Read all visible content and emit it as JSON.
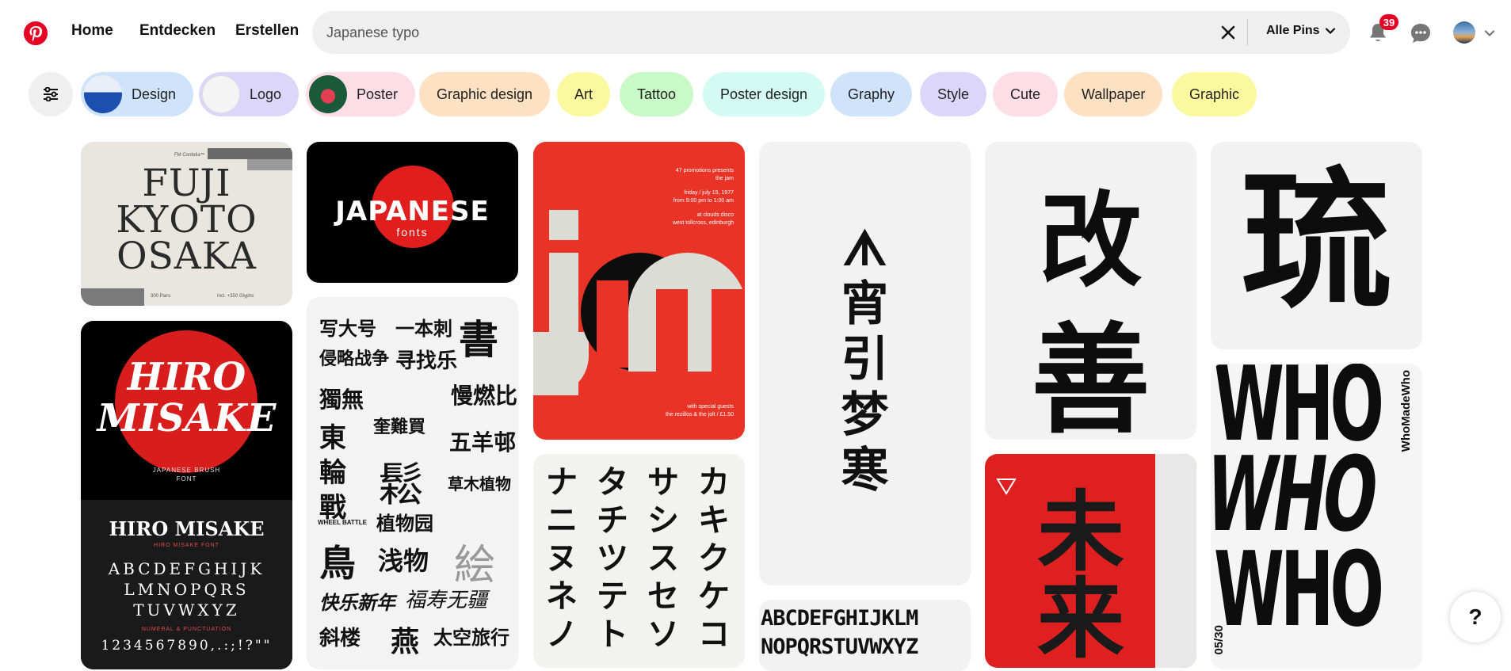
{
  "header": {
    "nav": [
      "Home",
      "Entdecken",
      "Erstellen"
    ],
    "search": {
      "value": "Japanese typo",
      "scope": "Alle Pins"
    },
    "notifications_count": "39"
  },
  "filters": {
    "chips": [
      {
        "label": "Design",
        "color": "#cfe3fb"
      },
      {
        "label": "Logo",
        "color": "#ddd6fb"
      },
      {
        "label": "Poster",
        "color": "#fddde6"
      },
      {
        "label": "Graphic design",
        "color": "#fde1c2"
      },
      {
        "label": "Art",
        "color": "#fbf9a0"
      },
      {
        "label": "Tattoo",
        "color": "#c8f9c6"
      },
      {
        "label": "Poster design",
        "color": "#d3faf3"
      },
      {
        "label": "Graphy",
        "color": "#cfe3fb"
      },
      {
        "label": "Style",
        "color": "#ddd6fb"
      },
      {
        "label": "Cute",
        "color": "#fddde6"
      },
      {
        "label": "Wallpaper",
        "color": "#fde1c2"
      },
      {
        "label": "Graphic",
        "color": "#fbf9a0"
      }
    ]
  },
  "pins": {
    "fuji": {
      "lines": [
        "FUJI",
        "KYOTO",
        "OSAKA"
      ],
      "small_top": "FM Cordelia™",
      "small_left": "300 Pairs",
      "small_right": "Incl. +350 Glyphs"
    },
    "japanese_fonts": {
      "title": "JAPANESE",
      "subtitle": "fonts"
    },
    "hiro": {
      "title_1": "HIRO",
      "title_2": "MISAKE",
      "sub": "JAPANESE BRUSH",
      "sub2": "FONT",
      "name": "HIRO MISAKE",
      "small": "HIRO MISAKE FONT",
      "alpha_1": "ABCDEFGHIJK",
      "alpha_2": "LMNOPQRS",
      "alpha_3": "TUVWXYZ",
      "small2": "NUMERAL & PUNCTUATION",
      "digits": "1234567890,.:;!?\"\""
    },
    "jam": {
      "letters": "jam",
      "info_1": "47 promotions presents",
      "info_2": "the jam",
      "info_3": "friday / july 15, 1977",
      "info_4": "from 9:00 pm to 1:00 am",
      "info_5": "at clouds disco",
      "info_6": "west tollcross, edinburgh",
      "info_7": "with special guests",
      "info_8": "the rezillos & the jolt / £1.50"
    },
    "katakana": {
      "rows": [
        "ナタサカ",
        "ニチシキ",
        "ヌツスク",
        "ネテセケ",
        "ノトソコ"
      ]
    },
    "vertical_type": {
      "glyphs": [
        "ᗑ",
        "宵",
        "引",
        "梦",
        "寒"
      ]
    },
    "alphabet_strip": {
      "line_1": "ABCDEFGHIJKLM",
      "line_2": "NOPQRSTUVWXYZ"
    },
    "kaizen": {
      "glyph_1": "改",
      "glyph_2": "善"
    },
    "red_poster": {
      "glyph": "未来"
    },
    "blob": {
      "glyph": "琉"
    },
    "who": {
      "side": "WhoMadeWho",
      "date": "05/30",
      "letters": "WHO"
    },
    "collage": {
      "items": [
        "写大号",
        "一本刺",
        "書",
        "侵略战争",
        "寻找乐",
        "慢燃比",
        "獨無",
        "奎難買",
        "東",
        "五羊邨",
        "輪",
        "鬆",
        "草木植物",
        "戰",
        "植物园",
        "鳥",
        "浅物",
        "絵",
        "快乐新年",
        "福寿无疆",
        "斜楼",
        "燕",
        "太空旅行",
        "WHEEL BATTLE"
      ]
    }
  }
}
